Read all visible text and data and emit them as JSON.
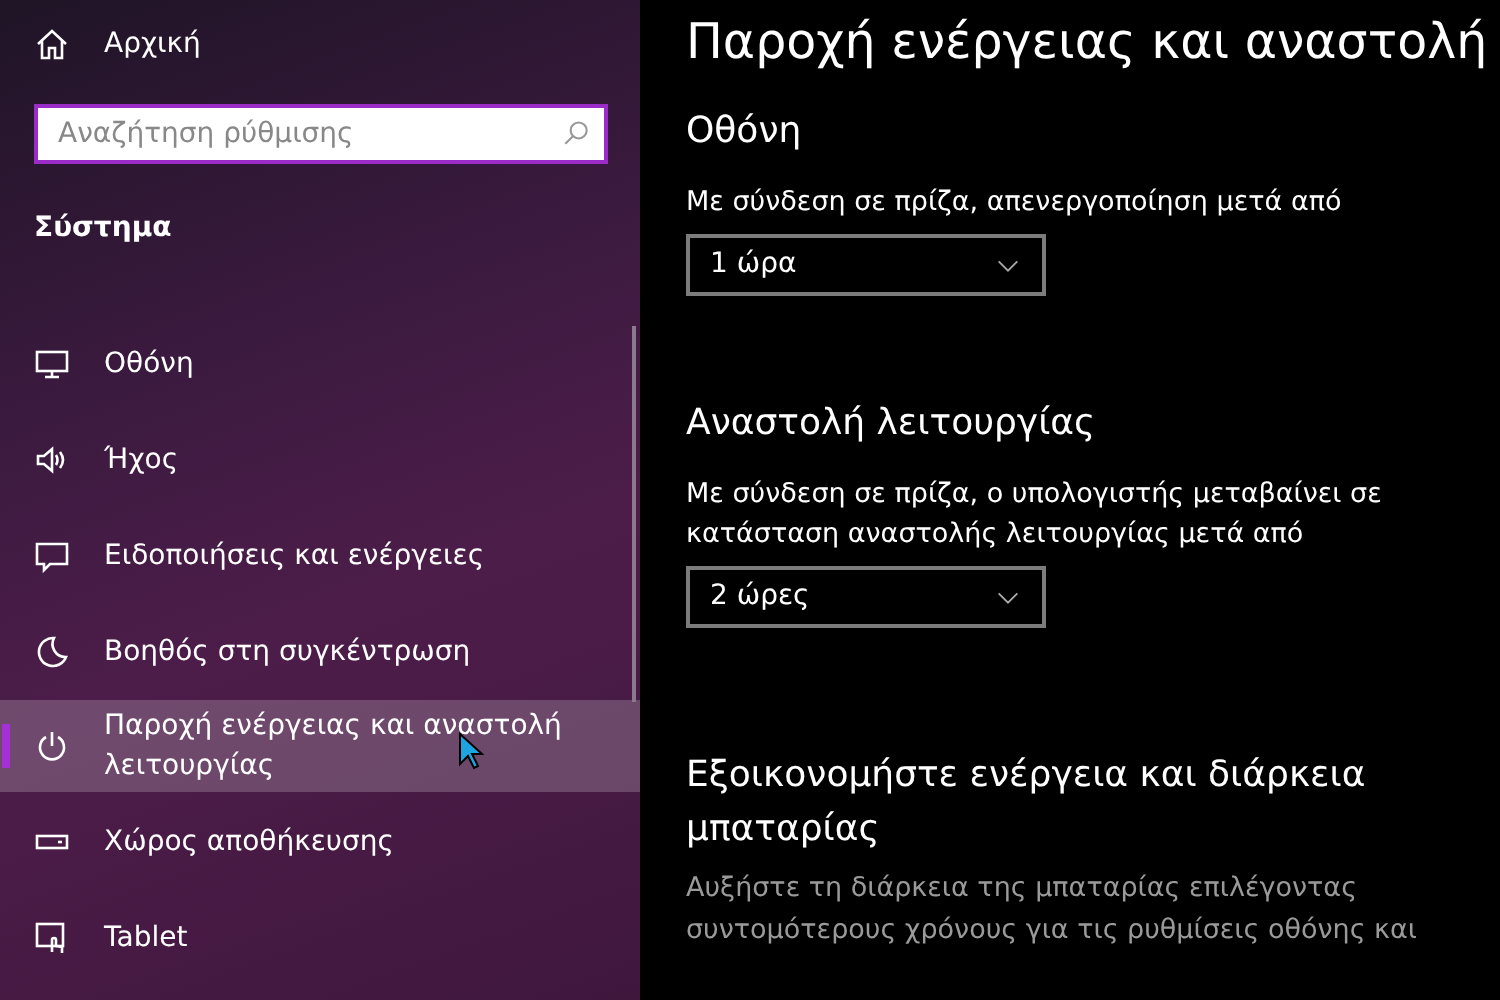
{
  "sidebar": {
    "home": "Αρχική",
    "search": {
      "placeholder": "Αναζήτηση ρύθμισης"
    },
    "section": "Σύστημα",
    "items": [
      {
        "label": "Οθόνη",
        "selected": false
      },
      {
        "label": "Ήχος",
        "selected": false
      },
      {
        "label": "Ειδοποιήσεις και ενέργειες",
        "selected": false
      },
      {
        "label": "Βοηθός στη συγκέντρωση",
        "selected": false
      },
      {
        "label": "Παροχή ενέργειας και αναστολή λειτουργίας",
        "selected": true
      },
      {
        "label": "Χώρος αποθήκευσης",
        "selected": false
      },
      {
        "label": "Tablet",
        "selected": false
      }
    ]
  },
  "main": {
    "title": "Παροχή ενέργειας και αναστολή",
    "sections": [
      {
        "heading": "Οθόνη",
        "label": "Με σύνδεση σε πρίζα, απενεργοποίηση μετά από",
        "value": "1 ώρα"
      },
      {
        "heading": "Αναστολή λειτουργίας",
        "label": "Με σύνδεση σε πρίζα, ο υπολογιστής μεταβαίνει σε κατάσταση αναστολής λειτουργίας μετά από",
        "value": "2 ώρες"
      }
    ],
    "tip": {
      "heading": "Εξοικονομήστε ενέργεια και διάρκεια μπαταρίας",
      "text": "Αυξήστε τη διάρκεια της μπαταρίας επιλέγοντας συντομότερους χρόνους για τις ρυθμίσεις οθόνης και"
    }
  }
}
